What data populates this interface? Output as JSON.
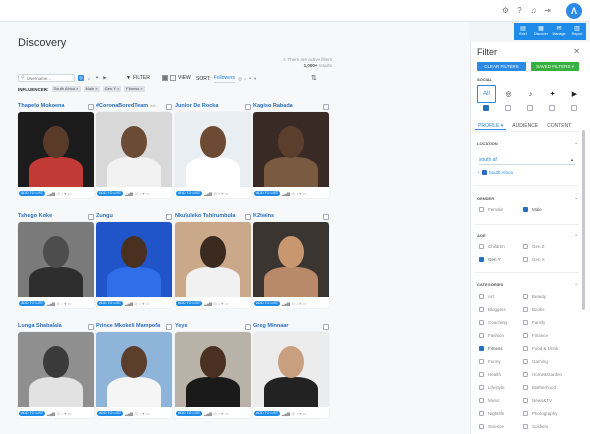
{
  "topbar": {
    "icons": [
      "gear-icon",
      "help-icon",
      "bell-icon",
      "logout-icon"
    ],
    "logo": "Λ",
    "nav": [
      {
        "icon": "▤",
        "label": "Brief"
      },
      {
        "icon": "▦",
        "label": "Discover"
      },
      {
        "icon": "✉",
        "label": "Manage"
      },
      {
        "icon": "▥",
        "label": "Report"
      }
    ]
  },
  "main": {
    "title": "Discovery",
    "active_filters": {
      "line1": "There are active filters",
      "count": "1,000+",
      "suffix": "results"
    },
    "search": {
      "placeholder": "Username..."
    },
    "filter_label": "FILTER",
    "view_label": "VIEW",
    "sort_label": "SORT:",
    "sort_value": "Followers",
    "influencer_label": "INFLUENCER:",
    "chips": [
      "South Africa ×",
      "Male ×",
      "Gen Y ×",
      "Fitness ×"
    ]
  },
  "cards": [
    {
      "name": "Thapelo Mokoena",
      "verified": "",
      "loc": ""
    },
    {
      "name": "#CoronaBoredTeam",
      "verified": "",
      "loc": "Joh..."
    },
    {
      "name": "Junior De Rocka",
      "verified": "",
      "loc": ""
    },
    {
      "name": "Kagiso Rabada",
      "verified": "",
      "loc": ""
    },
    {
      "name": "Tshego Koke",
      "verified": "",
      "loc": ""
    },
    {
      "name": "Zungu",
      "verified": "",
      "loc": ""
    },
    {
      "name": "Nkululeko Tshirumbula",
      "verified": "",
      "loc": ""
    },
    {
      "name": "K2twins",
      "verified": "",
      "loc": ""
    },
    {
      "name": "Lunga Shabalala",
      "verified": "",
      "loc": ""
    },
    {
      "name": "Prince Mkokeli Mampofa",
      "verified": "",
      "loc": ""
    },
    {
      "name": "Yeye",
      "verified": "",
      "loc": ""
    },
    {
      "name": "Greg Minnaar",
      "verified": "",
      "loc": ""
    }
  ],
  "card_common": {
    "add_to_list": "ADD TO LIST",
    "signal": "▂▄▆",
    "social_icons": "◎ ♪ ♥ ▭"
  },
  "filter_panel": {
    "title": "Filter",
    "clear_btn": "CLEAR FILTERS",
    "saved_btn": "SAVED FILTERS ▾",
    "social_label": "SOCIAL",
    "social_all": "All",
    "social_icons": [
      "instagram-icon",
      "tiktok-icon",
      "twitter-icon",
      "youtube-icon"
    ],
    "tabs": [
      "PROFILE ▾",
      "AUDIENCE",
      "CONTENT"
    ],
    "location_label": "LOCATION",
    "location_value": "south af",
    "location_option": "South Africa",
    "gender_label": "GENDER",
    "gender_options": [
      {
        "label": "Female",
        "checked": false
      },
      {
        "label": "Male",
        "checked": true
      }
    ],
    "age_label": "AGE",
    "age_options": [
      {
        "label": "Children",
        "checked": false
      },
      {
        "label": "Gen Z",
        "checked": false
      },
      {
        "label": "Gen Y",
        "checked": true
      },
      {
        "label": "Gen X",
        "checked": false
      }
    ],
    "categories_label": "CATEGORIES",
    "categories": [
      {
        "label": "Art",
        "checked": false
      },
      {
        "label": "Beauty",
        "checked": false
      },
      {
        "label": "Bloggers",
        "checked": false
      },
      {
        "label": "Books",
        "checked": false
      },
      {
        "label": "Coaching",
        "checked": false
      },
      {
        "label": "Family",
        "checked": false
      },
      {
        "label": "Fashion",
        "checked": false
      },
      {
        "label": "Finance",
        "checked": false
      },
      {
        "label": "Fitness",
        "checked": true
      },
      {
        "label": "Food & Drink",
        "checked": false
      },
      {
        "label": "Funny",
        "checked": false
      },
      {
        "label": "Gaming",
        "checked": false
      },
      {
        "label": "Health",
        "checked": false
      },
      {
        "label": "Home&Garden",
        "checked": false
      },
      {
        "label": "Lifestyle",
        "checked": false
      },
      {
        "label": "Motherhood",
        "checked": false
      },
      {
        "label": "Music",
        "checked": false
      },
      {
        "label": "News&TV",
        "checked": false
      },
      {
        "label": "Nightlife",
        "checked": false
      },
      {
        "label": "Photography",
        "checked": false
      },
      {
        "label": "Science",
        "checked": false
      },
      {
        "label": "Soldiers",
        "checked": false
      }
    ]
  }
}
